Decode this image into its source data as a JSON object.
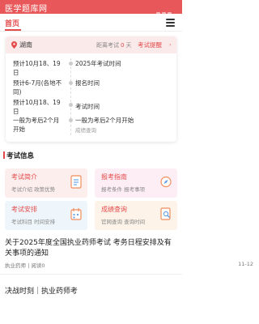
{
  "app": {
    "title": "医学题库网"
  },
  "colors": {
    "accent": "#e34a4a",
    "header": "#e8585a",
    "card_head": "#fbeaea"
  },
  "nav": {
    "home_label": "首页",
    "menu_icon": "hamburger-menu-icon"
  },
  "exam_card": {
    "region": "湖南",
    "countdown_prefix": "距离考试",
    "countdown_value": "0",
    "countdown_unit": "天",
    "remind_label": "考试提醒",
    "timeline": [
      {
        "left": "预计10月18、19日",
        "right": "2025年考试时间",
        "sub": ""
      },
      {
        "left": "预计6-7月(各地不同)",
        "right": "报名时间",
        "sub": ""
      },
      {
        "left": "预计10月18、19日",
        "right": "考试时间",
        "sub": ""
      },
      {
        "left": "一般为考后2个月开始",
        "right": "一般为考后2个月开始",
        "sub": "成绩查询"
      }
    ]
  },
  "exam_info": {
    "section_title": "考试信息",
    "tiles": [
      {
        "title": "考试简介",
        "desc": "考试介绍 政策优势",
        "icon": "document-icon",
        "bg": "#fdeeee"
      },
      {
        "title": "报考指南",
        "desc": "报考条件 报考事项",
        "icon": "compass-icon",
        "bg": "#fdeef5"
      },
      {
        "title": "考试安排",
        "desc": "考试科目 时间安排",
        "icon": "calendar-icon",
        "bg": "#eef6fb"
      },
      {
        "title": "成绩查询",
        "desc": "官网查询 查询时间",
        "icon": "search-doc-icon",
        "bg": "#fdf3e9"
      }
    ]
  },
  "news": [
    {
      "title": "关于2025年度全国执业药师考试 考务日程安排及有关事项的通知",
      "category": "执业药师",
      "views": "阅读0",
      "date": "11-12"
    },
    {
      "title": "决战时刻｜执业药师考",
      "category": "",
      "views": "",
      "date": ""
    }
  ]
}
